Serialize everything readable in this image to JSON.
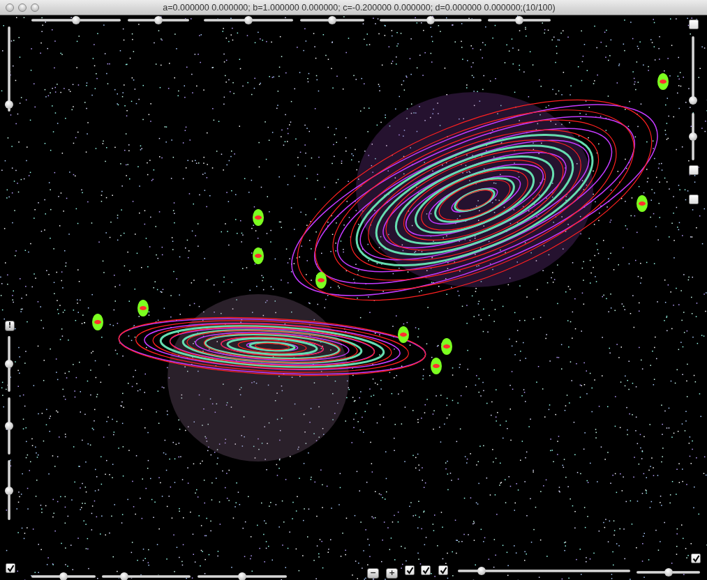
{
  "window": {
    "title": "a=0.000000 0.000000; b=1.000000 0.000000; c=-0.200000 0.000000; d=0.000000 0.000000;(10/100)"
  },
  "top_controls": [
    {
      "kind": "slider",
      "level": 0.5
    },
    {
      "kind": "slider",
      "level": 0.5
    },
    {
      "kind": "slider",
      "level": 0.5
    },
    {
      "kind": "slider",
      "level": 0.5
    },
    {
      "kind": "slider",
      "level": 0.5
    },
    {
      "kind": "slider",
      "level": 0.5
    }
  ],
  "left_controls": [
    {
      "kind": "slider",
      "level": 0.04
    },
    {
      "kind": "button",
      "label": "!"
    },
    {
      "kind": "slider",
      "level": 0.5
    },
    {
      "kind": "slider",
      "level": 0.5
    },
    {
      "kind": "slider",
      "level": 0.48
    }
  ],
  "right_controls": [
    {
      "kind": "checkbox",
      "checked": false
    },
    {
      "kind": "slider",
      "level": 0
    },
    {
      "kind": "slider",
      "level": 0.5
    },
    {
      "kind": "checkbox",
      "checked": false
    },
    {
      "kind": "checkbox",
      "checked": false
    }
  ],
  "bottom_controls": [
    {
      "kind": "checkbox",
      "checked": true
    },
    {
      "kind": "slider",
      "level": 0.5
    },
    {
      "kind": "slider",
      "level": 0.23
    },
    {
      "kind": "slider",
      "level": 0.5
    },
    {
      "kind": "button",
      "label": "−"
    },
    {
      "kind": "button",
      "label": "+"
    },
    {
      "kind": "checkbox",
      "checked": true
    },
    {
      "kind": "checkbox",
      "checked": true
    },
    {
      "kind": "checkbox",
      "checked": true
    },
    {
      "kind": "slider",
      "level": 0.12
    },
    {
      "kind": "slider",
      "level": 0.5
    },
    {
      "kind": "checkbox",
      "checked": true
    }
  ]
}
